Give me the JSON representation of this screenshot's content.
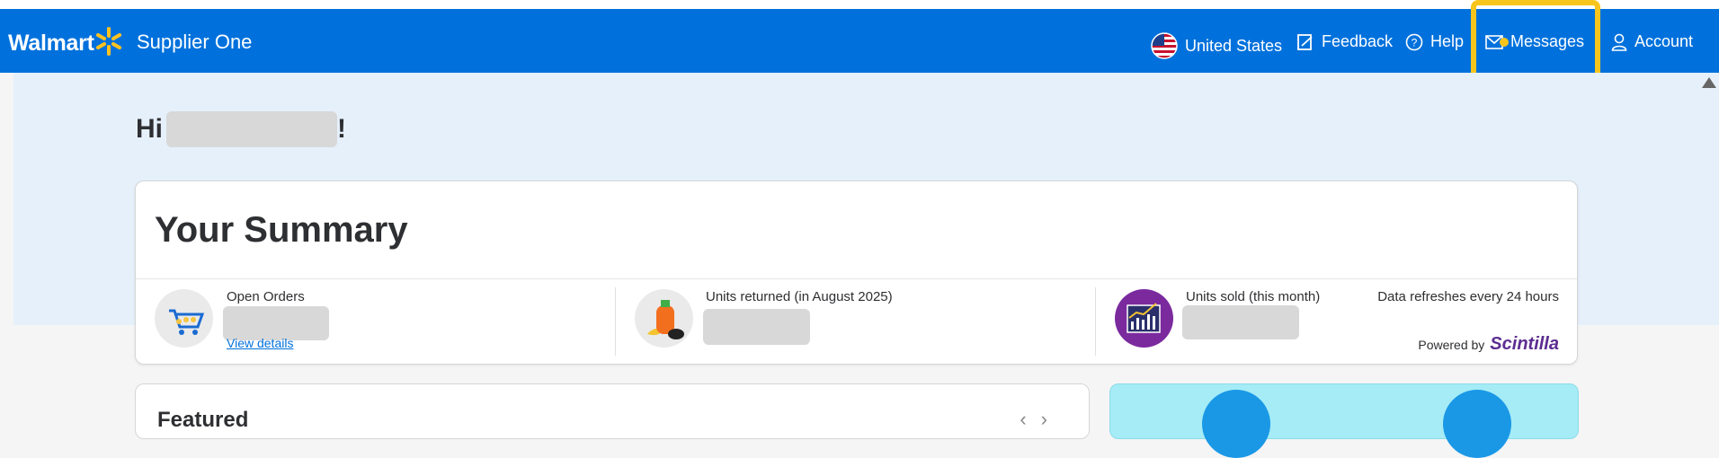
{
  "header": {
    "brand": "Walmart",
    "product": "Supplier One",
    "nav": {
      "country": "United States",
      "feedback": "Feedback",
      "help": "Help",
      "messages": "Messages",
      "account": "Account"
    }
  },
  "greeting": {
    "prefix": "Hi",
    "suffix": "!"
  },
  "summary": {
    "title": "Your Summary",
    "metrics": [
      {
        "label": "Open Orders",
        "link": "View details"
      },
      {
        "label": "Units returned (in August 2025)"
      },
      {
        "label": "Units sold (this month)"
      }
    ],
    "refresh_note": "Data refreshes every 24 hours",
    "powered_by": "Powered by",
    "powered_brand": "Scintilla"
  },
  "featured": {
    "title": "Featured"
  },
  "colors": {
    "brand_blue": "#0071dc",
    "spark_yellow": "#ffc220",
    "highlight": "#f8c51c",
    "hero_bg": "#e5f0fb"
  },
  "icons": [
    "walmart-spark-icon",
    "us-flag-icon",
    "feedback-icon",
    "help-icon",
    "mail-icon",
    "user-icon",
    "cart-icon",
    "detergent-icon",
    "sales-chart-icon"
  ]
}
